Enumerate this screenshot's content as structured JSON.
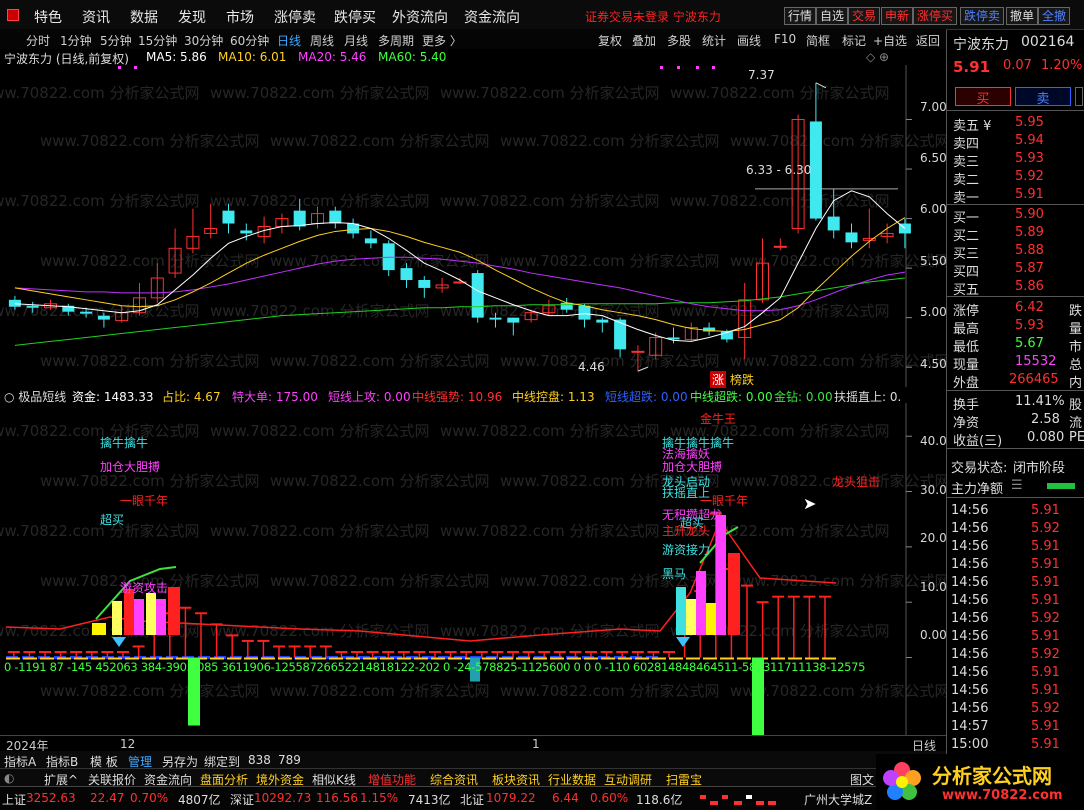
{
  "menu": {
    "items": [
      "特色",
      "资讯",
      "数据",
      "发现",
      "市场",
      "涨停卖",
      "跌停买",
      "外资流向",
      "资金流向"
    ],
    "notice": "证券交易未登录 宁波东力",
    "right_buttons": [
      "行情",
      "自选",
      "交易",
      "申新",
      "涨停买",
      "跌停卖",
      "撤单",
      "全撤"
    ]
  },
  "period": {
    "items": [
      "分时",
      "1分钟",
      "5分钟",
      "15分钟",
      "30分钟",
      "60分钟",
      "日线",
      "周线",
      "月线",
      "多周期",
      "更多 〉"
    ],
    "selected": "日线",
    "tools": [
      "复权",
      "叠加",
      "多股",
      "统计",
      "画线",
      "F10",
      "简框",
      "标记",
      "+自选",
      "返回"
    ]
  },
  "main_chart": {
    "title": "宁波东力 (日线,前复权)",
    "ma5": "MA5: 5.86",
    "ma10": "MA10: 6.01",
    "ma20": "MA20: 5.46",
    "ma60": "MA60: 5.40",
    "annot_high": "7.37",
    "annot_low": "4.46",
    "annot_range": "6.33 - 6.30",
    "y_ticks": [
      "7.00",
      "6.50",
      "6.00",
      "5.50",
      "5.00",
      "4.50"
    ],
    "badge_zhang": "涨",
    "badge_bang": "榜跌"
  },
  "chart_data": {
    "type": "candlestick",
    "candles": [
      [
        5.18,
        5.11,
        5.22,
        5.08
      ],
      [
        5.12,
        5.1,
        5.16,
        5.05
      ],
      [
        5.1,
        5.14,
        5.18,
        5.08
      ],
      [
        5.12,
        5.06,
        5.14,
        5.02
      ],
      [
        5.06,
        5.04,
        5.1,
        5.0
      ],
      [
        5.02,
        4.98,
        5.05,
        4.9
      ],
      [
        4.97,
        5.05,
        5.12,
        4.95
      ],
      [
        5.05,
        5.2,
        5.35,
        5.02
      ],
      [
        5.2,
        5.4,
        5.55,
        5.15
      ],
      [
        5.45,
        5.7,
        5.9,
        5.4
      ],
      [
        5.7,
        5.82,
        6.1,
        5.65
      ],
      [
        5.85,
        5.9,
        6.15,
        5.8
      ],
      [
        6.08,
        5.95,
        6.15,
        5.85
      ],
      [
        5.88,
        5.85,
        5.95,
        5.78
      ],
      [
        5.82,
        5.92,
        6.02,
        5.75
      ],
      [
        5.92,
        6.0,
        6.05,
        5.85
      ],
      [
        6.08,
        5.92,
        6.2,
        5.88
      ],
      [
        5.95,
        6.05,
        6.12,
        5.9
      ],
      [
        6.08,
        5.95,
        6.12,
        5.9
      ],
      [
        5.95,
        5.85,
        6.0,
        5.8
      ],
      [
        5.8,
        5.75,
        5.88,
        5.7
      ],
      [
        5.75,
        5.48,
        5.78,
        5.42
      ],
      [
        5.5,
        5.38,
        5.55,
        5.3
      ],
      [
        5.38,
        5.3,
        5.42,
        5.2
      ],
      [
        5.3,
        5.33,
        5.4,
        5.25
      ],
      [
        5.36,
        5.36,
        5.4,
        5.34
      ],
      [
        5.45,
        5.0,
        5.48,
        4.95
      ],
      [
        5.0,
        4.98,
        5.05,
        4.9
      ],
      [
        5.0,
        4.95,
        5.0,
        4.82
      ],
      [
        4.98,
        5.05,
        5.08,
        4.95
      ],
      [
        5.05,
        5.12,
        5.18,
        5.02
      ],
      [
        5.15,
        5.08,
        5.2,
        5.05
      ],
      [
        5.12,
        4.98,
        5.14,
        4.9
      ],
      [
        4.98,
        4.95,
        5.0,
        4.85
      ],
      [
        4.98,
        4.68,
        5.0,
        4.6
      ],
      [
        4.66,
        4.66,
        4.72,
        4.46
      ],
      [
        4.62,
        4.8,
        4.85,
        4.58
      ],
      [
        4.8,
        4.78,
        4.9,
        4.74
      ],
      [
        4.78,
        4.9,
        4.95,
        4.76
      ],
      [
        4.9,
        4.86,
        4.95,
        4.82
      ],
      [
        4.86,
        4.78,
        4.88,
        4.75
      ],
      [
        4.8,
        5.18,
        5.35,
        4.58
      ],
      [
        5.18,
        5.55,
        5.8,
        5.15
      ],
      [
        5.72,
        5.72,
        5.8,
        5.68
      ],
      [
        5.9,
        7.0,
        7.05,
        5.85
      ],
      [
        6.98,
        6.0,
        7.37,
        5.98
      ],
      [
        6.02,
        5.88,
        6.3,
        5.8
      ],
      [
        5.86,
        5.76,
        5.95,
        5.7
      ],
      [
        5.78,
        5.8,
        6.1,
        5.7
      ],
      [
        5.82,
        5.85,
        5.95,
        5.75
      ],
      [
        5.95,
        5.85,
        6.0,
        5.7
      ]
    ],
    "ma5": [
      5.14,
      5.13,
      5.12,
      5.11,
      5.09,
      5.07,
      5.05,
      5.07,
      5.13,
      5.28,
      5.43,
      5.6,
      5.75,
      5.82,
      5.88,
      5.92,
      5.93,
      5.95,
      5.96,
      5.95,
      5.9,
      5.8,
      5.68,
      5.55,
      5.47,
      5.38,
      5.27,
      5.2,
      5.13,
      5.07,
      5.02,
      5.02,
      5.04,
      5.02,
      4.95,
      4.88,
      4.82,
      4.77,
      4.76,
      4.8,
      4.85,
      4.91,
      5.05,
      5.2,
      5.55,
      5.9,
      6.18,
      6.28,
      6.22,
      6.05,
      5.9
    ],
    "ma10": [
      5.3,
      5.27,
      5.24,
      5.21,
      5.18,
      5.15,
      5.12,
      5.11,
      5.12,
      5.18,
      5.26,
      5.35,
      5.45,
      5.55,
      5.63,
      5.7,
      5.77,
      5.83,
      5.87,
      5.89,
      5.9,
      5.87,
      5.82,
      5.76,
      5.71,
      5.66,
      5.58,
      5.48,
      5.39,
      5.3,
      5.22,
      5.15,
      5.12,
      5.08,
      5.05,
      5.02,
      4.98,
      4.93,
      4.89,
      4.87,
      4.86,
      4.88,
      4.93,
      4.98,
      5.1,
      5.28,
      5.45,
      5.62,
      5.77,
      5.9,
      6.01
    ],
    "ma20": [
      5.3,
      5.29,
      5.28,
      5.27,
      5.26,
      5.26,
      5.25,
      5.25,
      5.25,
      5.26,
      5.28,
      5.31,
      5.34,
      5.38,
      5.42,
      5.46,
      5.5,
      5.54,
      5.57,
      5.59,
      5.6,
      5.61,
      5.61,
      5.6,
      5.59,
      5.57,
      5.55,
      5.52,
      5.49,
      5.45,
      5.42,
      5.39,
      5.36,
      5.33,
      5.3,
      5.26,
      5.22,
      5.18,
      5.14,
      5.11,
      5.09,
      5.07,
      5.07,
      5.08,
      5.12,
      5.18,
      5.25,
      5.32,
      5.38,
      5.43,
      5.46
    ],
    "ma60": [
      4.72,
      4.74,
      4.76,
      4.78,
      4.8,
      4.82,
      4.84,
      4.86,
      4.88,
      4.9,
      4.92,
      4.94,
      4.96,
      4.98,
      5.0,
      5.02,
      5.03,
      5.04,
      5.05,
      5.06,
      5.07,
      5.08,
      5.09,
      5.1,
      5.1,
      5.11,
      5.11,
      5.12,
      5.12,
      5.13,
      5.13,
      5.13,
      5.14,
      5.14,
      5.14,
      5.14,
      5.14,
      5.15,
      5.15,
      5.15,
      5.16,
      5.17,
      5.19,
      5.21,
      5.24,
      5.27,
      5.3,
      5.33,
      5.36,
      5.38,
      5.4
    ],
    "ylim": [
      4.3,
      7.55
    ]
  },
  "indicator": {
    "name": "极品短线",
    "items": [
      "资金: 1483.33",
      "占比: 4.67",
      "特大单: 175.00",
      "短线上攻: 0.00",
      "中线强势: 10.96",
      "中线控盘: 1.13",
      "短线超跌: 0.00",
      "中线超跌: 0.00",
      "金钻: 0.00",
      "扶摇直上: 0."
    ],
    "y_ticks": [
      "40.00",
      "30.00",
      "20.00",
      "10.00",
      "0.00"
    ],
    "ylim": [
      -14,
      46
    ],
    "bars": [
      1,
      1,
      1,
      1,
      1,
      1,
      1,
      1,
      2,
      5,
      8,
      9,
      8,
      6,
      4,
      3,
      3,
      2,
      2,
      2,
      2,
      1,
      1,
      1,
      1,
      1,
      1,
      1,
      1,
      1,
      1,
      1,
      1,
      1,
      1,
      1,
      1,
      1,
      1,
      1,
      1,
      1,
      1,
      6,
      12,
      26,
      16,
      13,
      10,
      11,
      11,
      11,
      11
    ],
    "bottom_numbers": "0  -1191  87  -145 452063 384-3903 085 3611906-12558726652214818122-202  0   -24-578825-1125600    0    0     0   -110 602814848464511-586311711138-12575",
    "signals": [
      {
        "text": "擒牛擒牛",
        "color": "#40e0e0"
      },
      {
        "text": "加仓大胆搏",
        "color": "#ff40ff"
      },
      {
        "text": "一眼千年",
        "color": "#ff2020"
      },
      {
        "text": "超买",
        "color": "#40e0e0"
      },
      {
        "text": "游资攻击",
        "color": "#ff40ff"
      },
      {
        "text": "金牛王",
        "color": "#ff2020"
      },
      {
        "text": "擒牛擒牛擒牛",
        "color": "#40e0e0"
      },
      {
        "text": "法海擒妖",
        "color": "#ff40ff"
      },
      {
        "text": "加仓大胆搏",
        "color": "#ff40ff"
      },
      {
        "text": "龙头启动",
        "color": "#40e0e0"
      },
      {
        "text": "扶摇直上",
        "color": "#40e0e0"
      },
      {
        "text": "一眼千年",
        "color": "#ff2020"
      },
      {
        "text": "无积攒超龙",
        "color": "#ff40ff"
      },
      {
        "text": "超买",
        "color": "#40e0e0"
      },
      {
        "text": "主升龙头",
        "color": "#ff2020"
      },
      {
        "text": "游资接力",
        "color": "#40e0e0"
      },
      {
        "text": "黑马",
        "color": "#40e0e0"
      },
      {
        "text": "龙头狙击",
        "color": "#ff2020"
      }
    ]
  },
  "time_axis": {
    "labels": [
      "2024年",
      "12",
      "1"
    ],
    "period": "日线"
  },
  "tabs1": [
    "指标A",
    "指标B",
    "模 板",
    "管理",
    "另存为",
    "绑定到",
    "838",
    "789"
  ],
  "tabs2": [
    "扩展^",
    "关联报价",
    "资金流向",
    "盘面分析",
    "境外资金",
    "相似K线",
    "增值功能",
    "综合资讯",
    "板块资讯",
    "行业数据",
    "互动调研",
    "扫雷宝"
  ],
  "tabs2_last": "图文",
  "status": {
    "sh_label": "上证",
    "sh_val": "3252.63",
    "sh_chg": "22.47",
    "sh_pct": "0.70%",
    "sh_amt": "4807亿",
    "sz_label": "深证",
    "sz_val": "10292.73",
    "sz_chg": "116.56",
    "sz_pct": "1.15%",
    "sz_amt": "7413亿",
    "bz_label": "北证",
    "bz_val": "1079.22",
    "bz_chg": "6.44",
    "bz_pct": "0.60%",
    "bz_amt": "118.6亿",
    "ticker": "广州大学城Z"
  },
  "quote": {
    "name": "宁波东力",
    "code": "002164",
    "price": "5.91",
    "change": "0.07",
    "pct": "1.20%",
    "buy_btn": "买",
    "sell_btn": "卖",
    "asks": [
      [
        "卖五 ¥",
        "5.95"
      ],
      [
        "卖四",
        "5.94"
      ],
      [
        "卖三",
        "5.93"
      ],
      [
        "卖二",
        "5.92"
      ],
      [
        "卖一",
        "5.91"
      ]
    ],
    "bids": [
      [
        "买一",
        "5.90"
      ],
      [
        "买二",
        "5.89"
      ],
      [
        "买三",
        "5.88"
      ],
      [
        "买四",
        "5.87"
      ],
      [
        "买五",
        "5.86"
      ]
    ],
    "stats": [
      [
        "涨停",
        "6.42",
        "跌"
      ],
      [
        "最高",
        "5.93",
        "量"
      ],
      [
        "最低",
        "5.67",
        "市"
      ],
      [
        "现量",
        "15532",
        "总"
      ],
      [
        "外盘",
        "266465",
        "内"
      ]
    ],
    "stats2": [
      [
        "换手",
        "11.41%",
        "股"
      ],
      [
        "净资",
        "2.58",
        "流"
      ],
      [
        "收益(三)",
        "0.080",
        "PE"
      ]
    ],
    "trade_state_label": "交易状态:",
    "trade_state": "闭市阶段",
    "main_net": "主力净额",
    "ticks": [
      [
        "14:56",
        "5.91"
      ],
      [
        "14:56",
        "5.92"
      ],
      [
        "14:56",
        "5.91"
      ],
      [
        "14:56",
        "5.91"
      ],
      [
        "14:56",
        "5.91"
      ],
      [
        "14:56",
        "5.91"
      ],
      [
        "14:56",
        "5.92"
      ],
      [
        "14:56",
        "5.91"
      ],
      [
        "14:56",
        "5.92"
      ],
      [
        "14:56",
        "5.91"
      ],
      [
        "14:56",
        "5.91"
      ],
      [
        "14:56",
        "5.92"
      ],
      [
        "14:57",
        "5.91"
      ],
      [
        "15:00",
        "5.91"
      ]
    ]
  },
  "watermark": "www.70822.com 分析家公式网",
  "logo": {
    "text": "分析家公式网",
    "url": "www.70822.com"
  }
}
